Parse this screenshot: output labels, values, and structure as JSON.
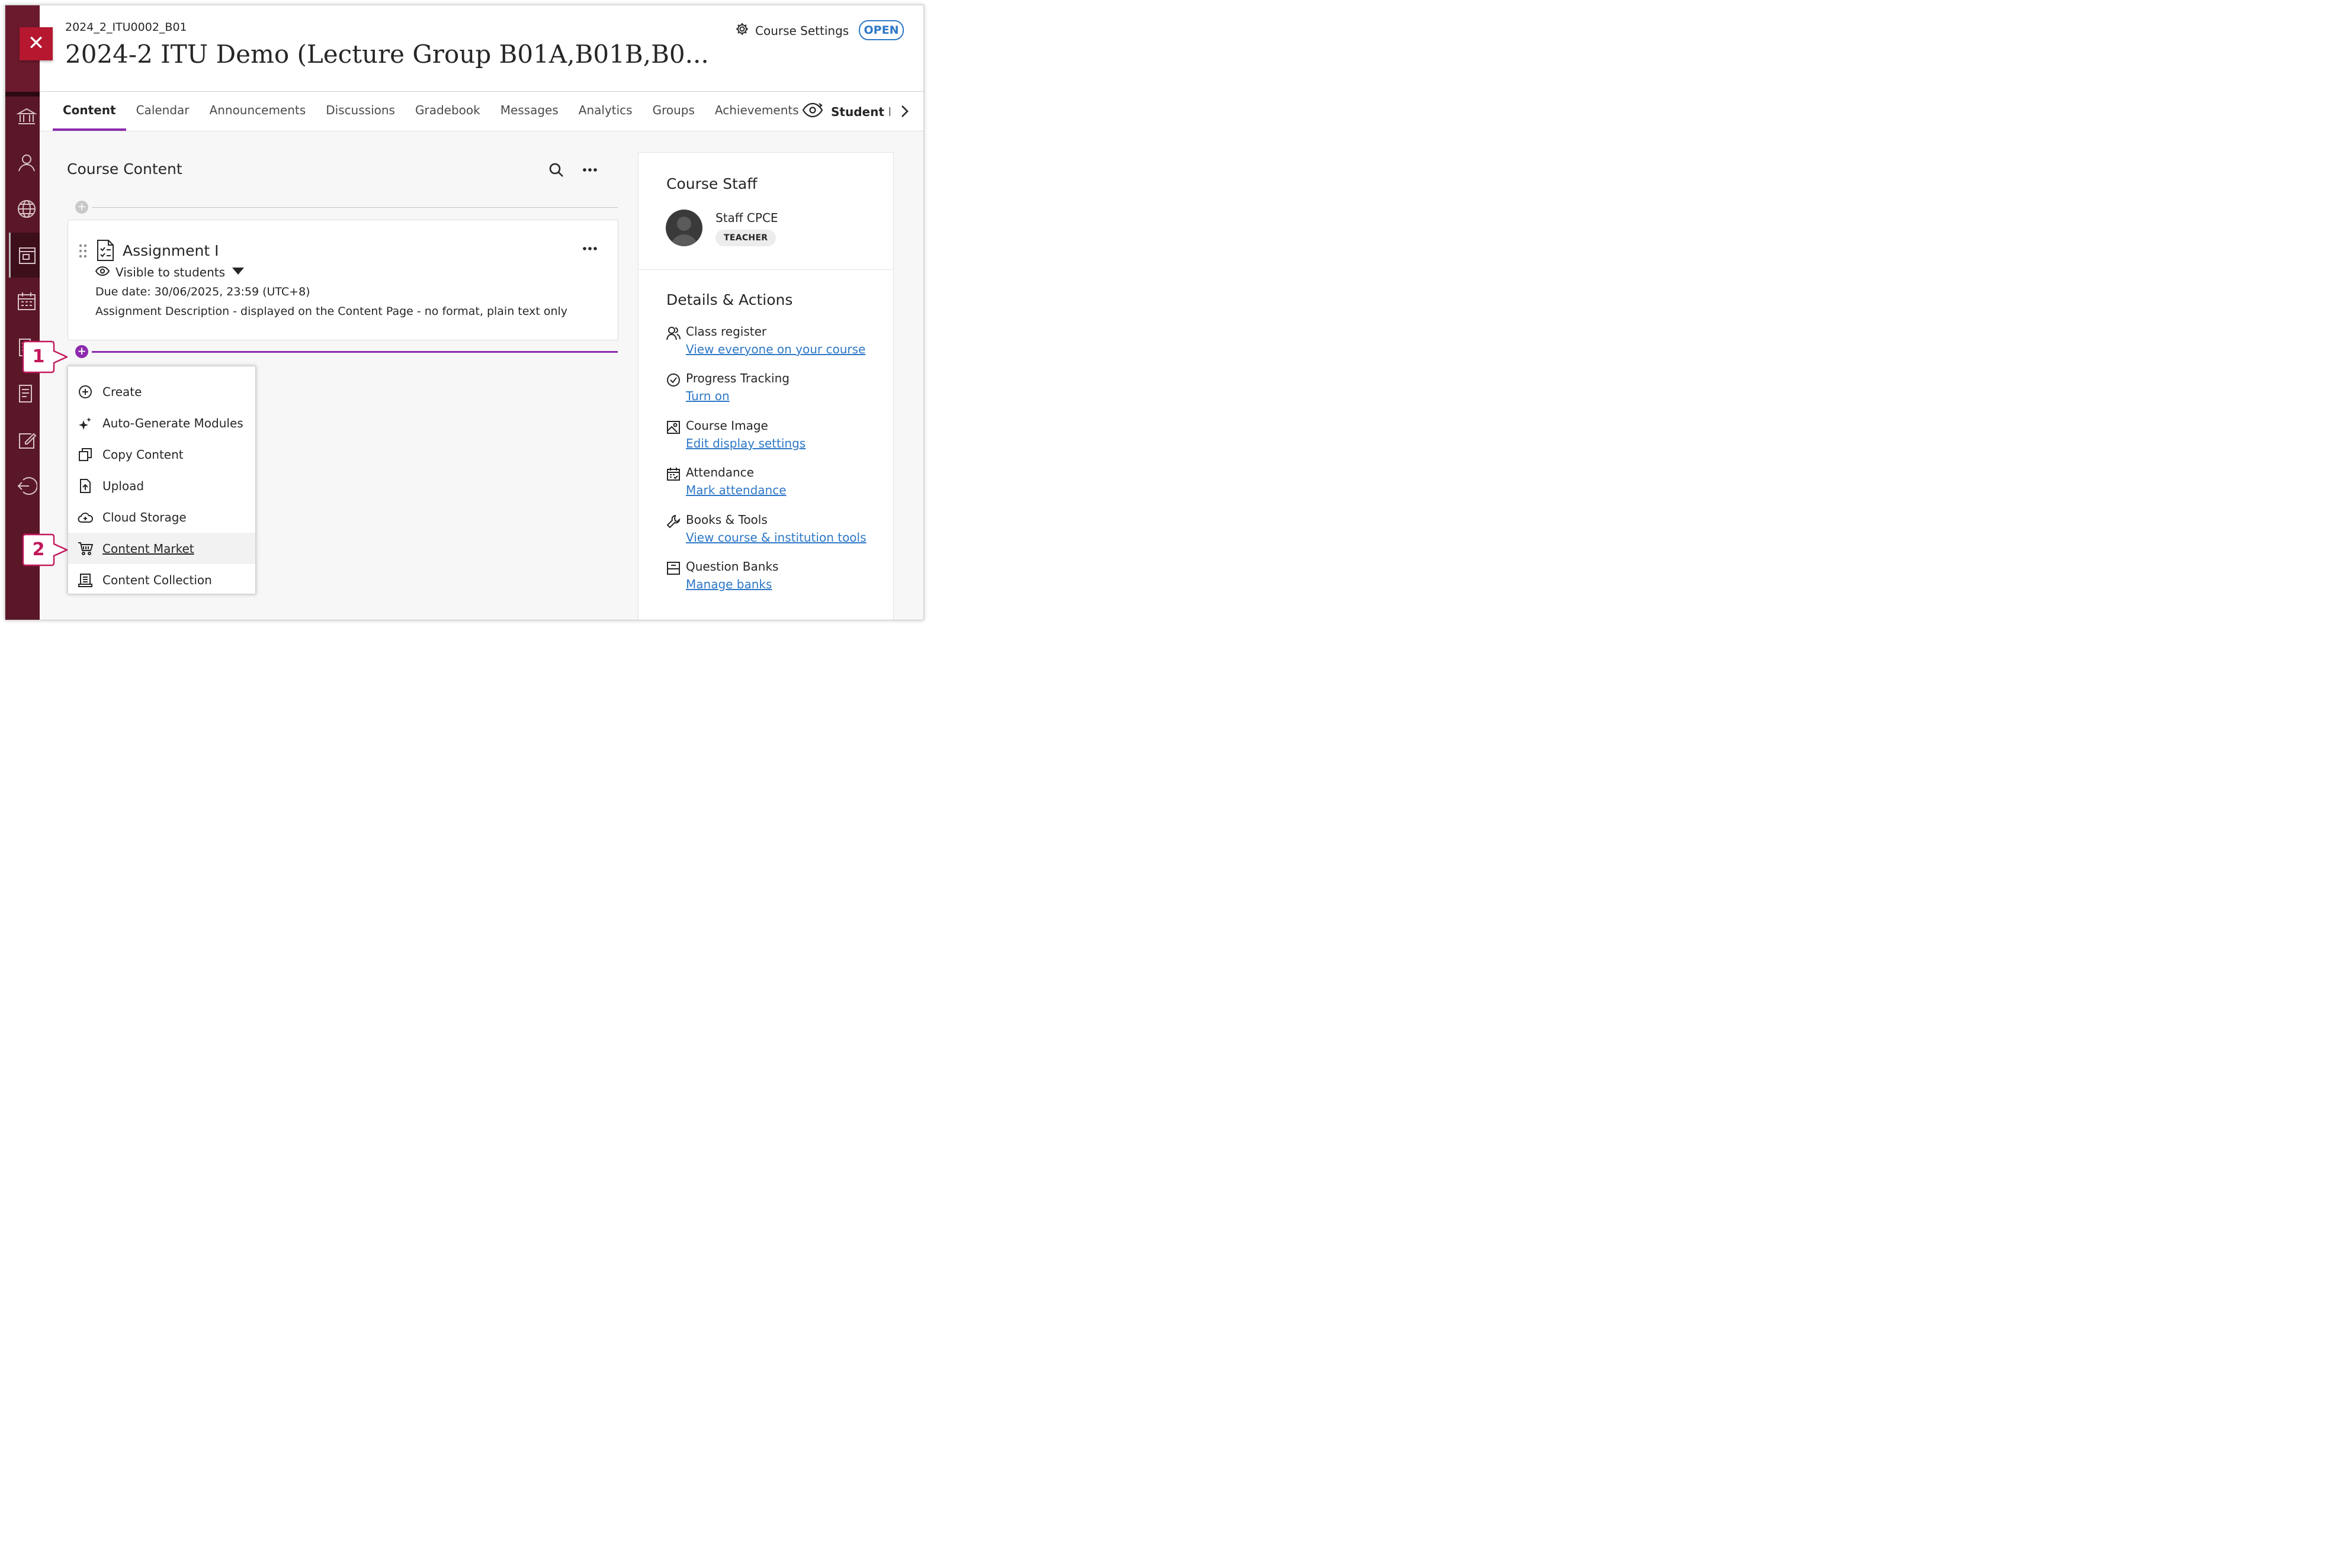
{
  "header": {
    "course_id": "2024_2_ITU0002_B01",
    "course_title": "2024-2 ITU Demo (Lecture Group B01A,B01B,B0...",
    "settings_label": "Course Settings",
    "status_badge": "OPEN",
    "close_glyph": "✕"
  },
  "tabs": [
    {
      "label": "Content",
      "active": true
    },
    {
      "label": "Calendar"
    },
    {
      "label": "Announcements"
    },
    {
      "label": "Discussions"
    },
    {
      "label": "Gradebook"
    },
    {
      "label": "Messages"
    },
    {
      "label": "Analytics"
    },
    {
      "label": "Groups"
    },
    {
      "label": "Achievements"
    }
  ],
  "student_preview_label": "Student Pı",
  "rail_icons": [
    "institution-icon",
    "profile-icon",
    "globe-icon",
    "courses-icon",
    "calendar-icon",
    "grades-icon",
    "edit-icon",
    "sign-out-icon"
  ],
  "content": {
    "section_title": "Course Content",
    "item": {
      "title": "Assignment I",
      "visibility": "Visible to students",
      "due_date": "Due date: 30/06/2025, 23:59 (UTC+8)",
      "description": "Assignment Description - displayed on the Content Page - no format, plain text only"
    }
  },
  "add_menu": {
    "items": [
      {
        "label": "Create",
        "icon": "plus-circle-icon"
      },
      {
        "label": "Auto-Generate Modules",
        "icon": "sparkle-icon"
      },
      {
        "label": "Copy Content",
        "icon": "copy-icon"
      },
      {
        "label": "Upload",
        "icon": "upload-icon"
      },
      {
        "label": "Cloud Storage",
        "icon": "cloud-icon"
      },
      {
        "label": "Content Market",
        "icon": "cart-icon",
        "hovered": true
      },
      {
        "label": "Content Collection",
        "icon": "collection-icon"
      }
    ]
  },
  "callouts": {
    "first": "1",
    "second": "2"
  },
  "colors": {
    "accent": "#8c2bad",
    "rail": "#5a1728",
    "close": "#b5182f",
    "link": "#2e78c7",
    "callout": "#c2185b"
  },
  "panel": {
    "staff_title": "Course Staff",
    "staff_name": "Staff CPCE",
    "staff_role": "TEACHER",
    "details_title": "Details & Actions",
    "details": [
      {
        "label": "Class register",
        "link": "View everyone on your course",
        "icon": "people-icon"
      },
      {
        "label": "Progress Tracking",
        "link": "Turn on",
        "icon": "check-circle-icon"
      },
      {
        "label": "Course Image",
        "link": "Edit display settings",
        "icon": "image-icon"
      },
      {
        "label": "Attendance",
        "link": "Mark attendance",
        "icon": "attendance-icon"
      },
      {
        "label": "Books & Tools",
        "link": "View course & institution tools",
        "icon": "wrench-icon"
      },
      {
        "label": "Question Banks",
        "link": "Manage banks",
        "icon": "bank-icon"
      }
    ]
  }
}
